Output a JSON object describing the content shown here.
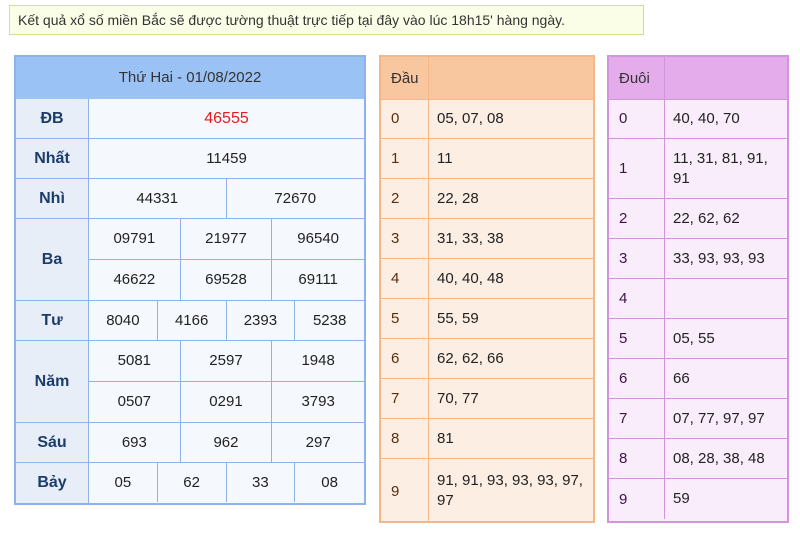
{
  "notice": "Kết quả xổ số miền Bắc sẽ được tường thuật trực tiếp tại đây vào lúc 18h15' hàng ngày.",
  "results": {
    "title": "Thứ Hai - 01/08/2022",
    "prizes": [
      {
        "label": "ĐB",
        "rows": [
          [
            "46555"
          ]
        ]
      },
      {
        "label": "Nhất",
        "rows": [
          [
            "11459"
          ]
        ]
      },
      {
        "label": "Nhì",
        "rows": [
          [
            "44331",
            "72670"
          ]
        ]
      },
      {
        "label": "Ba",
        "rows": [
          [
            "09791",
            "21977",
            "96540"
          ],
          [
            "46622",
            "69528",
            "69111"
          ]
        ]
      },
      {
        "label": "Tư",
        "rows": [
          [
            "8040",
            "4166",
            "2393",
            "5238"
          ]
        ]
      },
      {
        "label": "Năm",
        "rows": [
          [
            "5081",
            "2597",
            "1948"
          ],
          [
            "0507",
            "0291",
            "3793"
          ]
        ]
      },
      {
        "label": "Sáu",
        "rows": [
          [
            "693",
            "962",
            "297"
          ]
        ]
      },
      {
        "label": "Bảy",
        "rows": [
          [
            "05",
            "62",
            "33",
            "08"
          ]
        ]
      }
    ]
  },
  "dau": {
    "header": "Đầu",
    "header_value": "",
    "rows": [
      {
        "key": "0",
        "value": "05, 07, 08"
      },
      {
        "key": "1",
        "value": "11"
      },
      {
        "key": "2",
        "value": "22, 28"
      },
      {
        "key": "3",
        "value": "31, 33, 38"
      },
      {
        "key": "4",
        "value": "40, 40, 48"
      },
      {
        "key": "5",
        "value": "55, 59"
      },
      {
        "key": "6",
        "value": "62, 62, 66"
      },
      {
        "key": "7",
        "value": "70, 77"
      },
      {
        "key": "8",
        "value": "81"
      },
      {
        "key": "9",
        "value": "91, 91, 93, 93, 93, 97, 97"
      }
    ]
  },
  "duoi": {
    "header": "Đuôi",
    "header_value": "",
    "rows": [
      {
        "key": "0",
        "value": "40, 40, 70"
      },
      {
        "key": "1",
        "value": "11, 31, 81, 91, 91"
      },
      {
        "key": "2",
        "value": "22, 62, 62"
      },
      {
        "key": "3",
        "value": "33, 93, 93, 93"
      },
      {
        "key": "4",
        "value": ""
      },
      {
        "key": "5",
        "value": "05, 55"
      },
      {
        "key": "6",
        "value": "66"
      },
      {
        "key": "7",
        "value": "07, 77, 97, 97"
      },
      {
        "key": "8",
        "value": "08, 28, 38, 48"
      },
      {
        "key": "9",
        "value": "59"
      }
    ]
  },
  "colors": {
    "special_prize": "#e31c1c",
    "results_header": "#9bc2f5",
    "dau_header": "#f9c79f",
    "duoi_header": "#e5aceb"
  }
}
